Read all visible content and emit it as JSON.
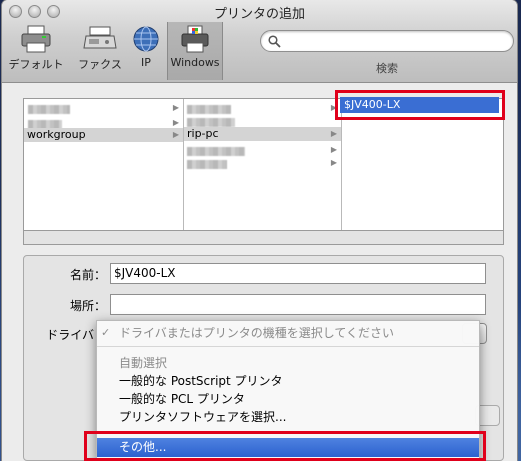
{
  "window": {
    "title": "プリンタの追加"
  },
  "toolbar": {
    "items": [
      {
        "label": "デフォルト",
        "icon": "printer-icon"
      },
      {
        "label": "ファクス",
        "icon": "fax-icon"
      },
      {
        "label": "IP",
        "icon": "globe-icon"
      },
      {
        "label": "Windows",
        "icon": "windows-printer-icon"
      }
    ],
    "selected": "Windows",
    "search": {
      "placeholder": "",
      "label": "検索"
    }
  },
  "browser": {
    "column1": {
      "selected": "workgroup"
    },
    "column2": {
      "selected": "rip-pc"
    },
    "column3": {
      "selected": "$JV400-LX"
    }
  },
  "form": {
    "name_label": "名前：",
    "name_value": "$JV400-LX",
    "location_label": "場所：",
    "location_value": "",
    "driver_label": "ドライバ"
  },
  "driver_menu": {
    "items": [
      {
        "label": "ドライバまたはプリンタの機種を選択してください",
        "checked": true,
        "dim": true
      },
      {
        "label": "自動選択",
        "dim": true
      },
      {
        "label": "一般的な PostScript プリンタ"
      },
      {
        "label": "一般的な PCL プリンタ"
      },
      {
        "label": "プリンタソフトウェアを選択..."
      },
      {
        "label": "その他...",
        "highlighted": true
      }
    ]
  },
  "colors": {
    "selection": "#3a6ed3",
    "callout": "#e0001b"
  }
}
